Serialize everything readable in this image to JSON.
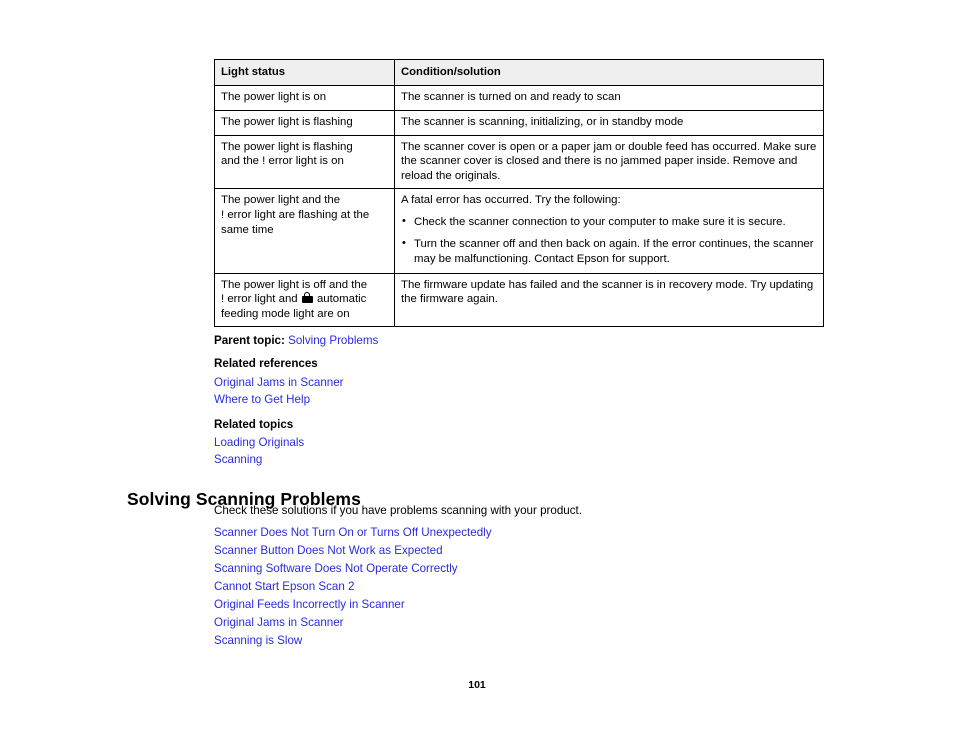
{
  "document": {
    "page_number": "101",
    "link_color": "#2b2be0",
    "header_bg": "#efefef"
  },
  "status_table": {
    "columns": [
      "Light status",
      "Condition/solution"
    ],
    "rows": [
      {
        "light_status_lines": [
          "The power light is on"
        ],
        "condition_paragraph": "The scanner is turned on and ready to scan",
        "bullets": []
      },
      {
        "light_status_lines": [
          "The power light is flashing"
        ],
        "condition_paragraph": "The scanner is scanning, initializing, or in standby mode",
        "bullets": []
      },
      {
        "light_status_lines": [
          "The power light is flashing",
          "and the ! error light is on"
        ],
        "condition_paragraph": "The scanner cover is open or a paper jam or double feed has occurred. Make sure the scanner cover is closed and there is no jammed paper inside. Remove and reload the originals.",
        "bullets": []
      },
      {
        "light_status_lines": [
          "The power light and the",
          "! error light are flashing at the",
          "same time"
        ],
        "condition_paragraph": "A fatal error has occurred. Try the following:",
        "bullets": [
          "Check the scanner connection to your computer to make sure it is secure.",
          "Turn the scanner off and then back on again. If the error continues, the scanner may be malfunctioning. Contact Epson for support."
        ]
      },
      {
        "light_status_lines": [
          "The power light is off and the",
          "! error light and [icon] automatic",
          "feeding mode light are on"
        ],
        "condition_paragraph": "The firmware update has failed and the scanner is in recovery mode. Try updating the firmware again.",
        "bullets": []
      }
    ],
    "row5_parts": {
      "line1": "The power light is off and the",
      "line2_before_icon": "! error light and ",
      "line2_after_icon": " automatic",
      "line3": "feeding mode light are on",
      "icon_name": "automatic-feeding-mode-icon"
    }
  },
  "topics": {
    "parent_topic_label": "Parent topic:",
    "parent_topic_link": "Solving Problems",
    "related_references_heading": "Related references",
    "related_references": [
      "Original Jams in Scanner",
      "Where to Get Help"
    ],
    "related_topics_heading": "Related topics",
    "related_topics": [
      "Loading Originals",
      "Scanning"
    ]
  },
  "section": {
    "heading": "Solving Scanning Problems",
    "intro": "Check these solutions if you have problems scanning with your product.",
    "links": [
      "Scanner Does Not Turn On or Turns Off Unexpectedly",
      "Scanner Button Does Not Work as Expected",
      "Scanning Software Does Not Operate Correctly",
      "Cannot Start Epson Scan 2",
      "Original Feeds Incorrectly in Scanner",
      "Original Jams in Scanner",
      "Scanning is Slow"
    ]
  }
}
